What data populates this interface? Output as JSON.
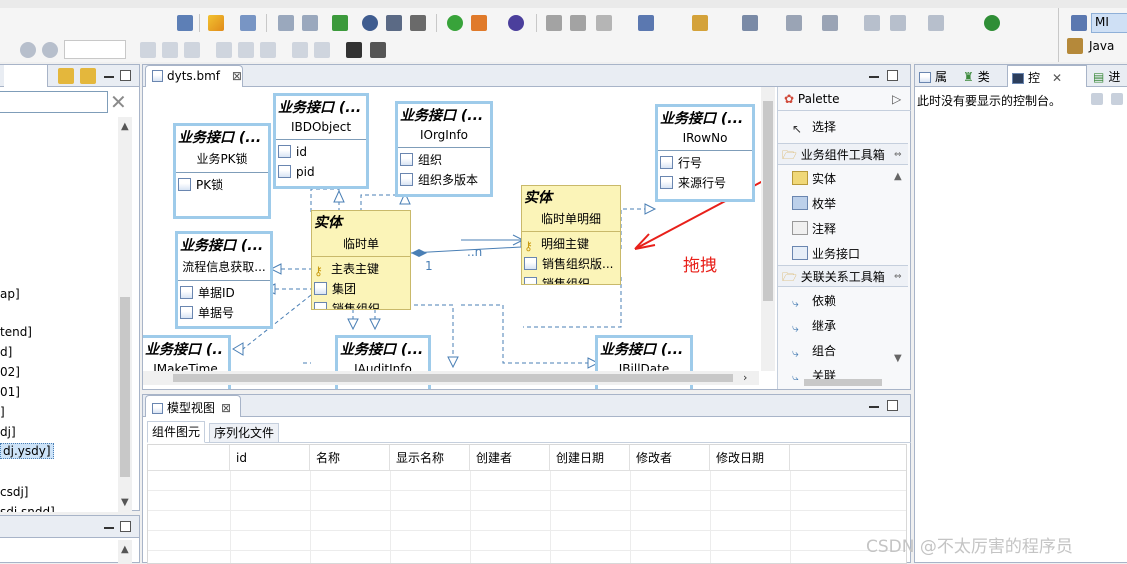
{
  "editor": {
    "tab_label": "dyts.bmf",
    "close_glyph": "⊠"
  },
  "palette": {
    "title": "Palette",
    "select_label": "选择",
    "drawer1": "业务组件工具箱",
    "drawer1_items": [
      "实体",
      "枚举",
      "注释",
      "业务接口"
    ],
    "drawer2": "关联关系工具箱",
    "drawer2_items": [
      "依赖",
      "继承",
      "组合",
      "关联"
    ]
  },
  "diagram": {
    "interface_header": "业务接口 (...",
    "interface_header_cut": "业务接口 (..",
    "entity_header": "实体",
    "drag_label": "拖拽",
    "mult_one": "1",
    "mult_many": "..n",
    "nodes": [
      {
        "name": "业务PK锁",
        "attrs": [
          "PK锁"
        ]
      },
      {
        "name": "IBDObject",
        "attrs": [
          "id",
          "pid"
        ]
      },
      {
        "name": "IOrgInfo",
        "attrs": [
          "组织",
          "组织多版本"
        ]
      },
      {
        "name": "IRowNo",
        "attrs": [
          "行号",
          "来源行号"
        ]
      },
      {
        "name": "流程信息获取...",
        "attrs": [
          "单据ID",
          "单据号"
        ]
      },
      {
        "name": "IMakeTime",
        "attrs": []
      },
      {
        "name": "IAuditInfo",
        "attrs": []
      },
      {
        "name": "IBillDate",
        "attrs": []
      }
    ],
    "entities": [
      {
        "name": "临时单",
        "attrs": [
          "主表主键",
          "集团",
          "销售组织"
        ]
      },
      {
        "name": "临时单明细",
        "attrs": [
          "明细主键",
          "销售组织版...",
          "销售组织"
        ]
      }
    ]
  },
  "model_view": {
    "tab_label": "模型视图",
    "subtabs": [
      "组件图元",
      "序列化文件"
    ],
    "columns": [
      "id",
      "名称",
      "显示名称",
      "创建者",
      "创建日期",
      "修改者",
      "修改日期"
    ]
  },
  "right_panel": {
    "tabs": [
      "属",
      "类",
      "控",
      "进"
    ],
    "message": "此时没有要显示的控制台。",
    "perspective_label": "Java",
    "mp_label": "MI"
  },
  "left_panel": {
    "items": [
      "ap]",
      "tend]",
      "d]",
      "02]",
      "01]",
      "]",
      "dj]",
      "dj.ysdy]",
      "csdj]",
      "sdj.sndd]"
    ]
  },
  "watermark": "CSDN @不太厉害的程序员",
  "colors": {
    "entity_bg": "#fbf4b8",
    "interface_border": "#9ecbea",
    "arrow": "#e8201a",
    "link": "#4a7fb5"
  }
}
